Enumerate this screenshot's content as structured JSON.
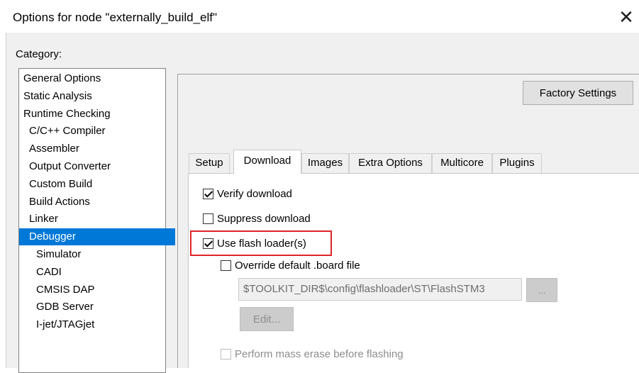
{
  "window": {
    "title": "Options for node \"externally_build_elf\"",
    "close_glyph": "✕"
  },
  "category": {
    "label": "Category:",
    "selected_index": 9,
    "items": [
      {
        "label": "General Options",
        "level": 0
      },
      {
        "label": "Static Analysis",
        "level": 0
      },
      {
        "label": "Runtime Checking",
        "level": 0
      },
      {
        "label": "C/C++ Compiler",
        "level": 1
      },
      {
        "label": "Assembler",
        "level": 1
      },
      {
        "label": "Output Converter",
        "level": 1
      },
      {
        "label": "Custom Build",
        "level": 1
      },
      {
        "label": "Build Actions",
        "level": 1
      },
      {
        "label": "Linker",
        "level": 1
      },
      {
        "label": "Debugger",
        "level": 1
      },
      {
        "label": "Simulator",
        "level": 2
      },
      {
        "label": "CADI",
        "level": 2
      },
      {
        "label": "CMSIS DAP",
        "level": 2
      },
      {
        "label": "GDB Server",
        "level": 2
      },
      {
        "label": "I-jet/JTAGjet",
        "level": 2
      }
    ]
  },
  "factory_settings_label": "Factory Settings",
  "tabs": [
    {
      "label": "Setup"
    },
    {
      "label": "Download",
      "active": true
    },
    {
      "label": "Images"
    },
    {
      "label": "Extra Options"
    },
    {
      "label": "Multicore"
    },
    {
      "label": "Plugins"
    }
  ],
  "download": {
    "verify": {
      "label": "Verify download",
      "checked": true
    },
    "suppress": {
      "label": "Suppress download",
      "checked": false
    },
    "flash_loader": {
      "label": "Use flash loader(s)",
      "checked": true
    },
    "override_board": {
      "label": "Override default .board file",
      "checked": false
    },
    "board_path": "$TOOLKIT_DIR$\\config\\flashloader\\ST\\FlashSTM3",
    "browse_label": "...",
    "edit_label": "Edit...",
    "mass_erase": {
      "label": "Perform mass erase before flashing",
      "checked": false
    }
  },
  "colors": {
    "selection": "#0078d7",
    "highlight_box": "#e0242a"
  }
}
